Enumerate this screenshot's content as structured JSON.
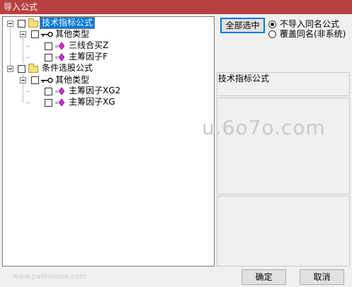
{
  "window": {
    "title": "导入公式",
    "title_bar_color": "#b8403f"
  },
  "tree": {
    "root1": {
      "label": "技术指标公式"
    },
    "root1_child": {
      "label": "其他类型"
    },
    "root1_leaves": [
      {
        "label": "三线合买Z"
      },
      {
        "label": "主筹因子F"
      }
    ],
    "root2": {
      "label": "条件选股公式"
    },
    "root2_child": {
      "label": "其他类型"
    },
    "root2_leaves": [
      {
        "label": "主筹因子XG2"
      },
      {
        "label": "主筹因子XG"
      }
    ]
  },
  "actions": {
    "select_all_label": "全部选中",
    "ok_label": "确定",
    "cancel_label": "取消"
  },
  "options": {
    "no_import_same_name": {
      "label": "不导入同名公式",
      "checked": true
    },
    "overwrite_same_name": {
      "label": "覆盖同名(非系统)",
      "checked": false
    }
  },
  "details": {
    "formula_name": "技术指标公式"
  },
  "watermarks": {
    "main": "u.6o7o.com",
    "footer": "www.palmindex.com"
  },
  "colors": {
    "selection": "#0078d7",
    "folder": "#f6e07a",
    "formula_icon": "#d12bd1"
  }
}
